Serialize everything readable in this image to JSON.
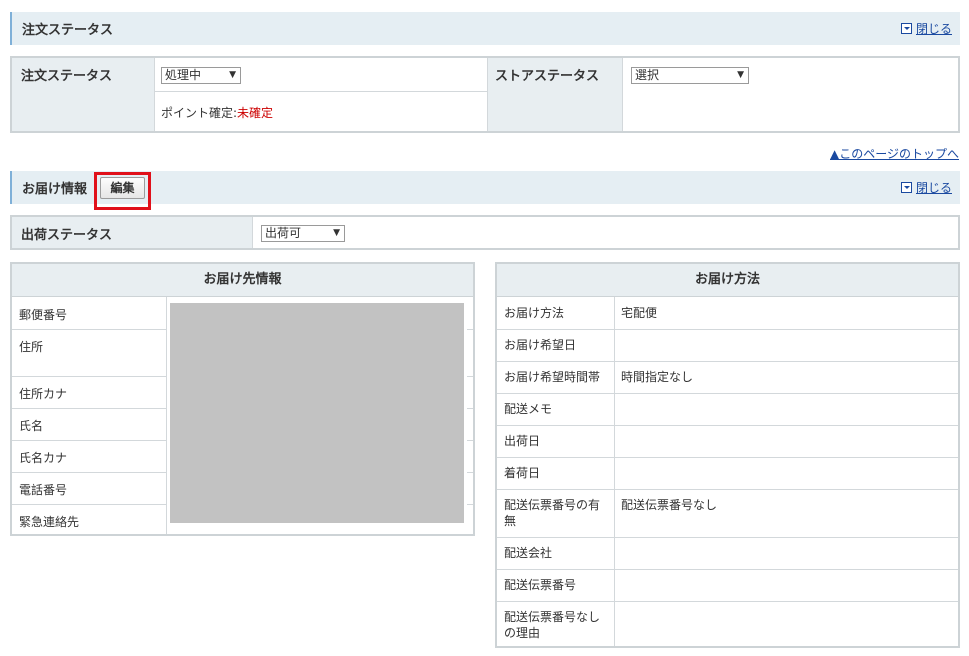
{
  "order_section": {
    "title": "注文ステータス",
    "close_label": "閉じる"
  },
  "order_table": {
    "order_status_label": "注文ステータス",
    "order_status_value": "処理中",
    "points_label": "ポイント確定:",
    "points_value": "未確定",
    "store_status_label": "ストアステータス",
    "store_status_value": "選択"
  },
  "top_link": "▲このページのトップへ",
  "delivery_section": {
    "title": "お届け情報",
    "edit_label": "編集",
    "close_label": "閉じる"
  },
  "shipping": {
    "label": "出荷ステータス",
    "value": "出荷可"
  },
  "destination": {
    "heading": "お届け先情報",
    "rows": [
      "郵便番号",
      "住所",
      "住所カナ",
      "氏名",
      "氏名カナ",
      "電話番号",
      "緊急連絡先"
    ]
  },
  "method": {
    "heading": "お届け方法",
    "rows": [
      {
        "label": "お届け方法",
        "value": "宅配便"
      },
      {
        "label": "お届け希望日",
        "value": ""
      },
      {
        "label": "お届け希望時間帯",
        "value": "時間指定なし"
      },
      {
        "label": "配送メモ",
        "value": ""
      },
      {
        "label": "出荷日",
        "value": ""
      },
      {
        "label": "着荷日",
        "value": ""
      },
      {
        "label": "配送伝票番号の有無",
        "value": "配送伝票番号なし"
      },
      {
        "label": "配送会社",
        "value": ""
      },
      {
        "label": "配送伝票番号",
        "value": ""
      },
      {
        "label": "配送伝票番号なしの理由",
        "value": ""
      }
    ]
  },
  "colors": {
    "header_bg": "#e5eef3",
    "link": "#1a49a0",
    "unconfirmed": "#cc0000",
    "highlight_frame": "#e0101a"
  }
}
